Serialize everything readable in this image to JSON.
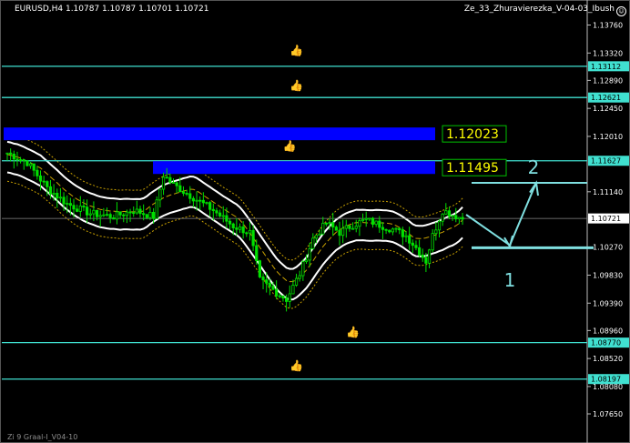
{
  "window": {
    "symbol_header": "EURUSD,H4  1.10787 1.10787 1.10701 1.10721",
    "indicator_name": "Ze_33_Zhuravierezka_V-04-03_Ibush",
    "indicator_icon": "smiley-icon",
    "footer_label": "Zi 9 Graal-I_V04-10"
  },
  "colors": {
    "background": "#000000",
    "candle": "#00e000",
    "level_line": "#40e0d0",
    "zone": "#0000ff",
    "band": "#ffffff",
    "dotted_band": "#c8a000",
    "annotation": "#7fdfe0",
    "zone_label_text": "#ffff00",
    "zone_label_border": "#00c000",
    "price_tag": "#40e0d0",
    "axis_text": "#ffffff"
  },
  "chart_data": {
    "type": "candlestick",
    "symbol": "EURUSD",
    "timeframe": "H4",
    "ylim": [
      1.0715,
      1.1395
    ],
    "price_ticks": [
      "1.13760",
      "1.13320",
      "1.12890",
      "1.12450",
      "1.12010",
      "1.11140",
      "1.10270",
      "1.09830",
      "1.09390",
      "1.08960",
      "1.08520",
      "1.08080",
      "1.07650"
    ],
    "level_lines": [
      {
        "price": 1.13112,
        "label": "1.13112"
      },
      {
        "price": 1.12621,
        "label": "1.12621"
      },
      {
        "price": 1.11627,
        "label": "1.11627"
      },
      {
        "price": 1.0877,
        "label": "1.08770"
      },
      {
        "price": 1.08197,
        "label": "1.08197"
      }
    ],
    "current_price": {
      "price": 1.10721,
      "label": "1.10721"
    },
    "zones": [
      {
        "top": 1.1215,
        "bottom": 1.1195,
        "label": "1.12023"
      },
      {
        "top": 1.1162,
        "bottom": 1.1142,
        "label": "1.11495"
      }
    ],
    "thumb_markers": [
      {
        "bar": 87,
        "price": 1.133
      },
      {
        "bar": 87,
        "price": 1.1275
      },
      {
        "bar": 85,
        "price": 1.118
      },
      {
        "bar": 104,
        "price": 1.0888
      },
      {
        "bar": 87,
        "price": 1.0835
      }
    ],
    "annotations": [
      {
        "text": "2",
        "price": 1.1122,
        "bar": 151
      },
      {
        "text": "1",
        "price": 1.0968,
        "bar": 145
      }
    ],
    "close_anchors": [
      [
        0,
        1.1175
      ],
      [
        6,
        1.116
      ],
      [
        12,
        1.112
      ],
      [
        18,
        1.1095
      ],
      [
        25,
        1.108
      ],
      [
        32,
        1.1075
      ],
      [
        38,
        1.1085
      ],
      [
        44,
        1.1075
      ],
      [
        47,
        1.114
      ],
      [
        50,
        1.1125
      ],
      [
        56,
        1.1105
      ],
      [
        62,
        1.1085
      ],
      [
        68,
        1.106
      ],
      [
        73,
        1.105
      ],
      [
        76,
        1.0975
      ],
      [
        80,
        1.096
      ],
      [
        84,
        1.0945
      ],
      [
        88,
        1.0985
      ],
      [
        92,
        1.104
      ],
      [
        96,
        1.1065
      ],
      [
        100,
        1.105
      ],
      [
        104,
        1.1062
      ],
      [
        108,
        1.107
      ],
      [
        112,
        1.1062
      ],
      [
        116,
        1.1055
      ],
      [
        120,
        1.1045
      ],
      [
        124,
        1.102
      ],
      [
        126,
        1.1005
      ],
      [
        128,
        1.1045
      ],
      [
        131,
        1.1085
      ],
      [
        134,
        1.1078
      ],
      [
        137,
        1.1072
      ]
    ]
  }
}
